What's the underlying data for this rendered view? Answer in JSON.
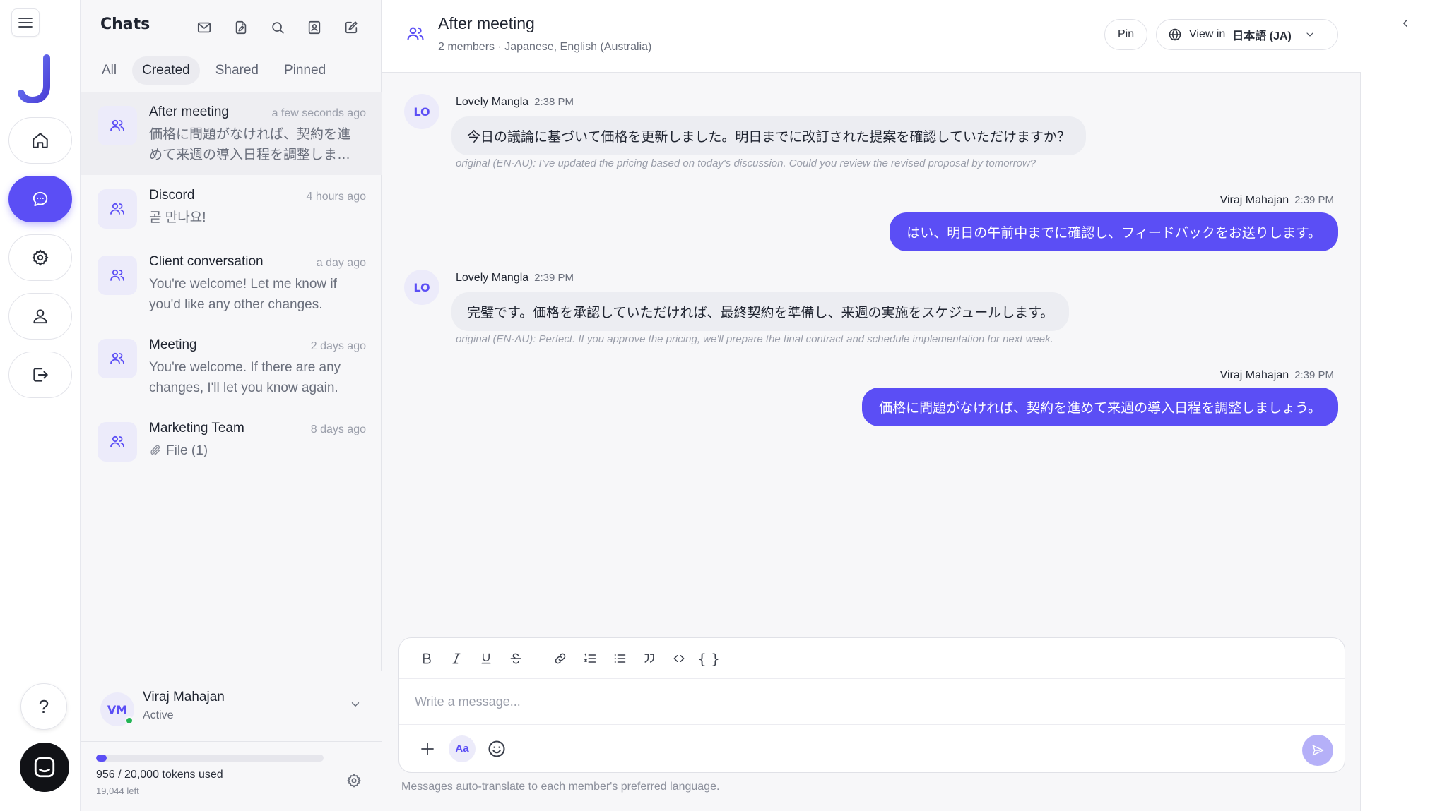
{
  "colors": {
    "accent": "#5b4ef5",
    "online": "#22b455"
  },
  "rail": {
    "items": [
      {
        "name": "home",
        "icon": "home-icon"
      },
      {
        "name": "chats",
        "icon": "chat-bubble-icon",
        "active": true
      },
      {
        "name": "settings",
        "icon": "gear-icon"
      },
      {
        "name": "profile",
        "icon": "user-icon"
      },
      {
        "name": "logout",
        "icon": "logout-icon"
      }
    ],
    "help_label": "?"
  },
  "chats": {
    "title": "Chats",
    "filters": [
      "All",
      "Created",
      "Shared",
      "Pinned"
    ],
    "active_filter": "Created",
    "items": [
      {
        "title": "After meeting",
        "time": "a few seconds ago",
        "preview": "価格に問題がなければ、契約を進めて来週の導入日程を調整しましょう。",
        "selected": true
      },
      {
        "title": "Discord",
        "time": "4 hours ago",
        "preview": "곧 만나요!"
      },
      {
        "title": "Client conversation",
        "time": "a day ago",
        "preview": "You're welcome! Let me know if you'd like any other changes."
      },
      {
        "title": "Meeting",
        "time": "2 days ago",
        "preview": "You're welcome. If there are any changes, I'll let you know again."
      },
      {
        "title": "Marketing Team",
        "time": "8 days ago",
        "preview": "File (1)",
        "attachment": true
      }
    ]
  },
  "user": {
    "initials": "VM",
    "name": "Viraj Mahajan",
    "status": "Active"
  },
  "usage": {
    "tokens_label": "956 / 20,000 tokens used",
    "left_label": "19,044 left",
    "used": 956,
    "total": 20000
  },
  "conversation": {
    "title": "After meeting",
    "subtitle": "2 members · Japanese, English (Australia)",
    "pin_label": "Pin",
    "view_in_label": "View in",
    "view_in_lang": "日本語 (JA)",
    "messages": [
      {
        "direction": "in",
        "initials": "LO",
        "sender": "Lovely Mangla",
        "time": "2:38 PM",
        "text": "今日の議論に基づいて価格を更新しました。明日までに改訂された提案を確認していただけますか？",
        "original": "original (EN-AU): I've updated the pricing based on today's discussion. Could you review the revised proposal by tomorrow?"
      },
      {
        "direction": "out",
        "sender": "Viraj Mahajan",
        "time": "2:39 PM",
        "text": "はい、明日の午前中までに確認し、フィードバックをお送りします。"
      },
      {
        "direction": "in",
        "initials": "LO",
        "sender": "Lovely Mangla",
        "time": "2:39 PM",
        "text": "完璧です。価格を承認していただければ、最終契約を準備し、来週の実施をスケジュールします。",
        "original": "original (EN-AU): Perfect. If you approve the pricing, we'll prepare the final contract and schedule implementation for next week."
      },
      {
        "direction": "out",
        "sender": "Viraj Mahajan",
        "time": "2:39 PM",
        "text": "価格に問題がなければ、契約を進めて来週の導入日程を調整しましょう。"
      }
    ],
    "composer": {
      "placeholder": "Write a message...",
      "font_button": "Aa",
      "code_block_label": "{ }"
    },
    "hint": "Messages auto-translate to each member's preferred language."
  }
}
